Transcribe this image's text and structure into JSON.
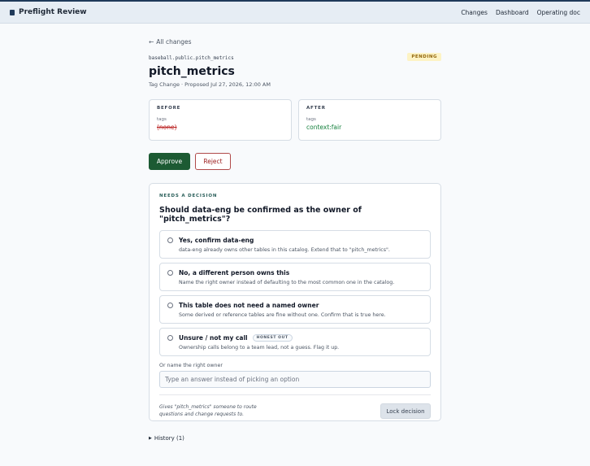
{
  "app": {
    "name": "Preflight Review",
    "nav": [
      "Changes",
      "Dashboard",
      "Operating doc"
    ]
  },
  "back_link": "All changes",
  "change": {
    "path": "baseball.public.pitch_metrics",
    "title": "pitch_metrics",
    "meta": "Tag Change · Proposed Jul 27, 2026, 12:00 AM",
    "status": "PENDING"
  },
  "diff": {
    "before": {
      "heading": "BEFORE",
      "key": "tags",
      "value": "(none)"
    },
    "after": {
      "heading": "AFTER",
      "key": "tags",
      "value": "context:fair"
    }
  },
  "actions": {
    "approve": "Approve",
    "reject": "Reject"
  },
  "decision": {
    "kicker": "NEEDS A DECISION",
    "question": "Should data-eng be confirmed as the owner of \"pitch_metrics\"?",
    "options": [
      {
        "title": "Yes, confirm data-eng",
        "desc": "data-eng already owns other tables in this catalog. Extend that to \"pitch_metrics\".",
        "tag": ""
      },
      {
        "title": "No, a different person owns this",
        "desc": "Name the right owner instead of defaulting to the most common one in the catalog.",
        "tag": ""
      },
      {
        "title": "This table does not need a named owner",
        "desc": "Some derived or reference tables are fine without one. Confirm that is true here.",
        "tag": ""
      },
      {
        "title": "Unsure / not my call",
        "desc": "Ownership calls belong to a team lead, not a guess. Flag it up.",
        "tag": "HONEST OUT"
      }
    ],
    "or_label": "Or name the right owner",
    "input_placeholder": "Type an answer instead of picking an option",
    "footnote": "Gives \"pitch_metrics\" someone to route questions and change requests to.",
    "lock_label": "Lock decision"
  },
  "history": "History (1)",
  "colors": {
    "approve": "#1c5a33",
    "reject": "#9b1c1c",
    "pending_bg": "#fdf3c4",
    "topbar": "#e6edf4"
  }
}
